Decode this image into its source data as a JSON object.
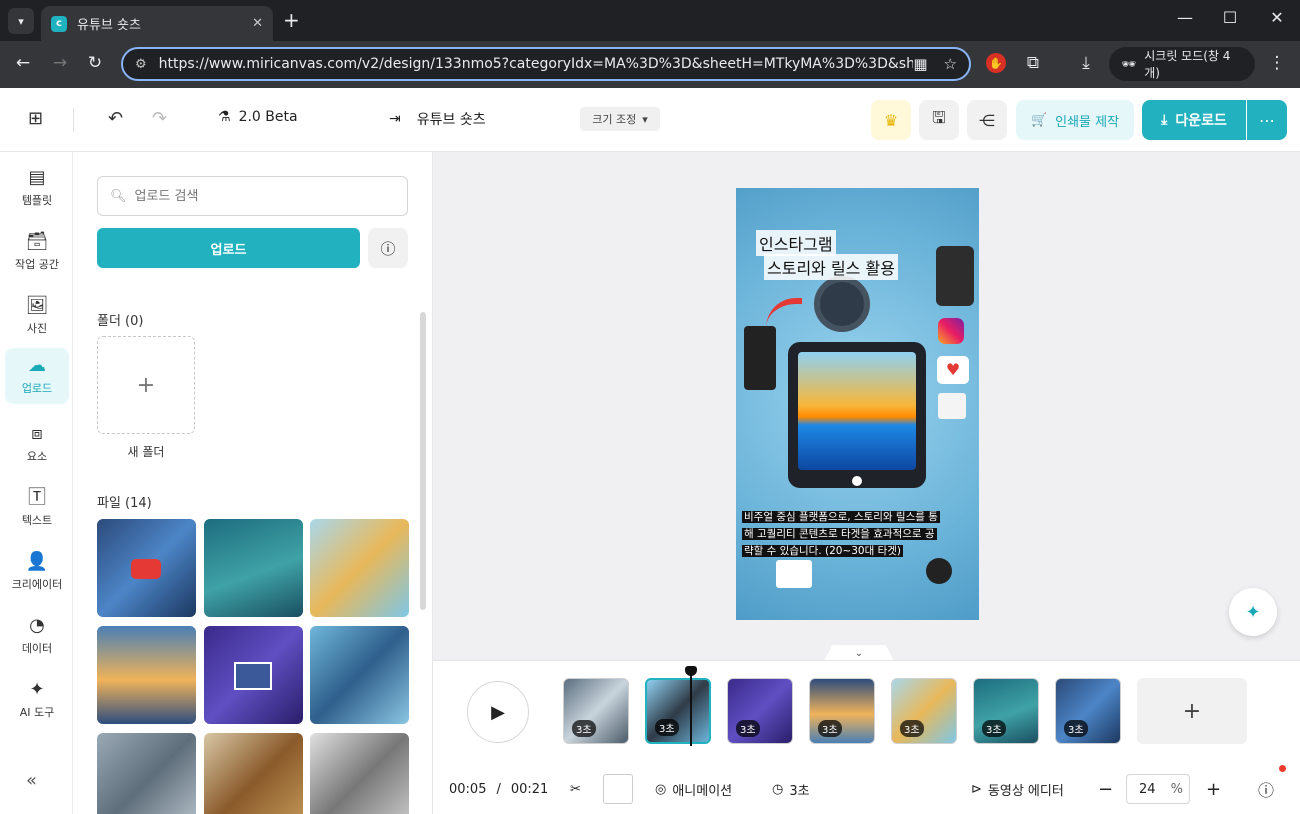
{
  "browser": {
    "tab_title": "유튜브 숏츠",
    "url": "https://www.miricanvas.com/v2/design/133nmo5?categoryIdx=MA%3D%3D&sheetH=MTkyMA%3D%3D&sheetW=...",
    "incognito_label": "시크릿 모드(창 4개)"
  },
  "header": {
    "version_label": "2.0 Beta",
    "doc_title": "유튜브 숏츠",
    "resize_label": "크기 조정",
    "print_label": "인쇄물 제작",
    "download_label": "다운로드"
  },
  "rail": {
    "items": [
      {
        "label": "템플릿",
        "icon": "template-icon"
      },
      {
        "label": "작업 공간",
        "icon": "workspace-icon"
      },
      {
        "label": "사진",
        "icon": "photo-icon"
      },
      {
        "label": "업로드",
        "icon": "upload-icon"
      },
      {
        "label": "요소",
        "icon": "elements-icon"
      },
      {
        "label": "텍스트",
        "icon": "text-icon"
      },
      {
        "label": "크리에이터",
        "icon": "creator-icon"
      },
      {
        "label": "데이터",
        "icon": "data-icon"
      },
      {
        "label": "AI 도구",
        "icon": "ai-tools-icon"
      }
    ]
  },
  "panel": {
    "search_placeholder": "업로드 검색",
    "upload_label": "업로드",
    "folders_title": "폴더 (0)",
    "new_folder_label": "새 폴더",
    "files_title": "파일 (14)"
  },
  "canvas": {
    "title_line1": "인스타그램",
    "title_line2": "스토리와 릴스 활용",
    "caption_line1": "비주얼 중심 플랫폼으로, 스토리와 릴스를 통",
    "caption_line2": "해 고퀄리티 콘텐츠로 타겟을 효과적으로 공",
    "caption_line3": "략할 수 있습니다. (20~30대 타겟)"
  },
  "timeline": {
    "clips": [
      {
        "duration": "3초"
      },
      {
        "duration": "3초"
      },
      {
        "duration": "3초"
      },
      {
        "duration": "3초"
      },
      {
        "duration": "3초"
      },
      {
        "duration": "3초"
      },
      {
        "duration": "3초"
      }
    ],
    "current_time": "00:05",
    "separator": "/",
    "total_time": "00:21",
    "animation_label": "애니메이션",
    "duration_label": "3초",
    "video_editor_label": "동영상 에디터",
    "zoom_value": "24",
    "zoom_unit": "%"
  },
  "colors": {
    "accent": "#21b1bf",
    "accent_light": "#e6f7f9"
  }
}
